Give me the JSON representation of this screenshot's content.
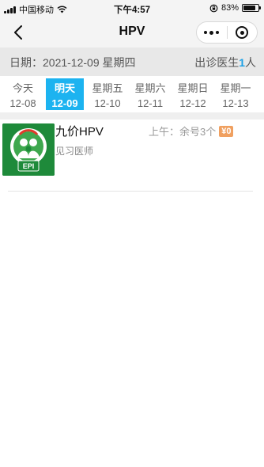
{
  "status_bar": {
    "carrier": "中国移动",
    "time": "下午4:57",
    "battery_percent": "83%",
    "battery_level": 0.83,
    "icons": [
      "signal-icon",
      "wifi-icon",
      "rotation-lock-icon",
      "battery-icon"
    ]
  },
  "nav": {
    "title": "HPV",
    "icons": [
      "back-icon",
      "more-icon",
      "close-miniprogram-icon"
    ]
  },
  "date_bar": {
    "date_label": "日期：",
    "date_value": "2021-12-09 星期四",
    "doctor_label": "出诊医生",
    "doctor_count": "1",
    "doctor_unit": "人"
  },
  "days": [
    {
      "label": "今天",
      "date": "12-08",
      "active": false
    },
    {
      "label": "明天",
      "date": "12-09",
      "active": true
    },
    {
      "label": "星期五",
      "date": "12-10",
      "active": false
    },
    {
      "label": "星期六",
      "date": "12-11",
      "active": false
    },
    {
      "label": "星期日",
      "date": "12-12",
      "active": false
    },
    {
      "label": "星期一",
      "date": "12-13",
      "active": false
    }
  ],
  "doctor": {
    "name": "九价HPV",
    "title": "见习医师",
    "slot_text": "上午：余号3个",
    "price": "¥0",
    "logo_text": "EPI",
    "logo_arc_text": "广东预防接种"
  },
  "colors": {
    "accent": "#1cb3f0",
    "count": "#1aa0e6",
    "price_badge": "#f0a060",
    "logo_green": "#1e8a3a"
  }
}
